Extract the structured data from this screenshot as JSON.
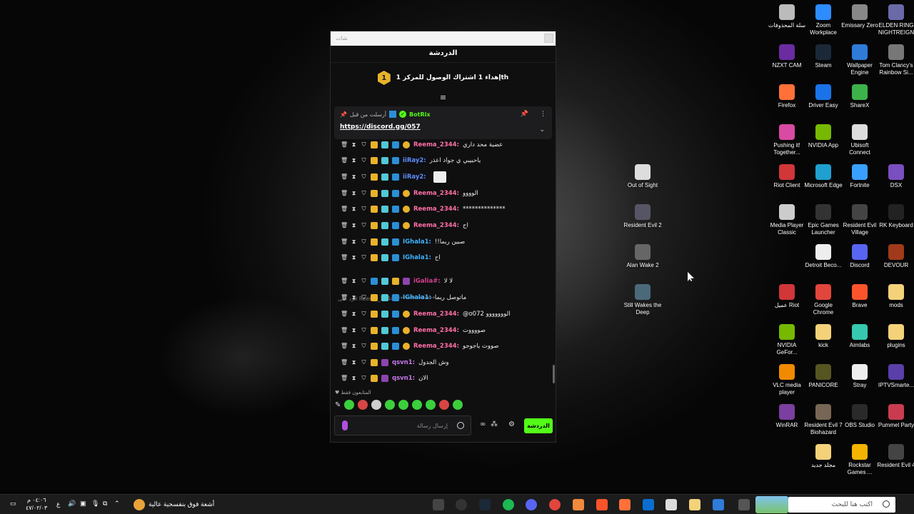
{
  "colors": {
    "kick_green": "#53fc18",
    "goal_gold": "#e8b22a",
    "chat_bg": "#0f0f10"
  },
  "chat": {
    "window_title": "شات",
    "header": "الدردشة",
    "goal": {
      "badge": "1",
      "text": "إهداء 1 اشتراك الوصول للمركز 1th"
    },
    "pinned": {
      "pinned_by_label": "أرسلت من قبل",
      "author": "BotRix",
      "link": "https://discord.gg/057"
    },
    "messages": [
      {
        "user": "Reema_2344:",
        "text": "عضية محد داري",
        "color": "#ff6fa5"
      },
      {
        "user": "iiRay2:",
        "text": "ياحبيبي ي جواد اعذر",
        "color": "#5b8dff"
      },
      {
        "user": "iiRay2:",
        "text": "",
        "color": "#5b8dff"
      },
      {
        "user": "Reema_2344:",
        "text": "الوووو",
        "color": "#ff6fa5"
      },
      {
        "user": "Reema_2344:",
        "text": "**************",
        "color": "#ff6fa5"
      },
      {
        "user": "Reema_2344:",
        "text": "اح",
        "color": "#ff6fa5"
      },
      {
        "user": "IGhala1:",
        "text": "!!صبين ربما",
        "color": "#3fb2ff"
      },
      {
        "user": "IGhala1:",
        "text": "اح",
        "color": "#3fb2ff"
      },
      {
        "user": "iGalia#:",
        "text": "لا لا",
        "color": "#d63f8c"
      },
      {
        "user": "IGhala1:",
        "text": "ماتوصل ربما",
        "color": "#3fb2ff"
      },
      {
        "user": "Reema_2344:",
        "text": "@o072 الووووووو",
        "color": "#ff6fa5"
      },
      {
        "user": "Reema_2344:",
        "text": "صووووت",
        "color": "#ff6fa5"
      },
      {
        "user": "Reema_2344:",
        "text": "صووت ياجوجو",
        "color": "#ff6fa5"
      },
      {
        "user": "qsvn1:",
        "text": "وش الجدول",
        "color": "#c878e8"
      },
      {
        "user": "qsvn1:",
        "text": "الان",
        "color": "#c878e8"
      }
    ],
    "reply_preview": "الرد على Reema_2344: **************",
    "emote_section_label": "المتابعون فقط",
    "input_placeholder": "إرسال رسالة",
    "send_button": "الدردشة"
  },
  "desktop": {
    "icons": [
      {
        "label": "ELDEN RING NIGHTREIGN",
        "color": "#6b6aa8"
      },
      {
        "label": "Emissary Zero",
        "color": "#888"
      },
      {
        "label": "Zoom Workplace",
        "color": "#2d8cff"
      },
      {
        "label": "سلة المحذوفات",
        "color": "#bbb"
      },
      {
        "label": "Tom Clancy's Rainbow Si...",
        "color": "#777"
      },
      {
        "label": "Wallpaper Engine",
        "color": "#2f7bd8"
      },
      {
        "label": "Steam",
        "color": "#1b2838"
      },
      {
        "label": "NZXT CAM",
        "color": "#6a2ca0"
      },
      {
        "label": "ShareX",
        "color": "#3db24a"
      },
      {
        "label": "Driver Easy",
        "color": "#1a73e8"
      },
      {
        "label": "Firefox",
        "color": "#ff7139"
      },
      {
        "label": "Ubisoft Connect",
        "color": "#ddd"
      },
      {
        "label": "NVIDIA App",
        "color": "#76b900"
      },
      {
        "label": "Pushing it! Together...",
        "color": "#d94aa2"
      },
      {
        "label": "Out of Sight",
        "color": "#ddd"
      },
      {
        "label": "DSX",
        "color": "#7a4fbf"
      },
      {
        "label": "Fortnite",
        "color": "#3aa0ff"
      },
      {
        "label": "Microsoft Edge",
        "color": "#1fa0d0"
      },
      {
        "label": "Riot Client",
        "color": "#d13639"
      },
      {
        "label": "Resident Evil 2",
        "color": "#556"
      },
      {
        "label": "RK Keyboard",
        "color": "#222"
      },
      {
        "label": "Resident Evil Village",
        "color": "#444"
      },
      {
        "label": "Epic Games Launcher",
        "color": "#333"
      },
      {
        "label": "Media Player Classic",
        "color": "#ccc"
      },
      {
        "label": "Alan Wake 2",
        "color": "#666"
      },
      {
        "label": "DEVOUR",
        "color": "#a03a1a"
      },
      {
        "label": "Discord",
        "color": "#5865f2"
      },
      {
        "label": "Detroit Beco...",
        "color": "#eee"
      },
      {
        "label": "Still Wakes the Deep",
        "color": "#4a6a7a"
      },
      {
        "label": "mods",
        "color": "#f4d27a"
      },
      {
        "label": "Brave",
        "color": "#fb542b"
      },
      {
        "label": "Google Chrome",
        "color": "#e2453c"
      },
      {
        "label": "عميل Riot",
        "color": "#d13639"
      },
      {
        "label": "plugins",
        "color": "#f4d27a"
      },
      {
        "label": "Aimlabs",
        "color": "#36c9b0"
      },
      {
        "label": "kick",
        "color": "#f4d27a"
      },
      {
        "label": "NVIDIA GeFor...",
        "color": "#76b900"
      },
      {
        "label": "IPTVSmarte...",
        "color": "#5a3fa8"
      },
      {
        "label": "Stray",
        "color": "#eee"
      },
      {
        "label": "PANICORE",
        "color": "#552"
      },
      {
        "label": "VLC media player",
        "color": "#f08a00"
      },
      {
        "label": "Pummel Party",
        "color": "#c93c4f"
      },
      {
        "label": "OBS Studio",
        "color": "#2a2a2a"
      },
      {
        "label": "Resident Evil 7 Biohazard",
        "color": "#765"
      },
      {
        "label": "WinRAR",
        "color": "#7a3fa0"
      },
      {
        "label": "Resident Evil 4",
        "color": "#444"
      },
      {
        "label": "Rockstar Games ...",
        "color": "#f4b400"
      },
      {
        "label": "مجلد جديد",
        "color": "#f4d27a"
      }
    ]
  },
  "taskbar": {
    "weather_text": "أشعة فوق بنفسجية عالية",
    "time": "٠٤:٠٦ م",
    "date": "٤٧/٠٢/٠٣",
    "lang": "ع",
    "search_placeholder": "اكتب هنا للبحث"
  }
}
